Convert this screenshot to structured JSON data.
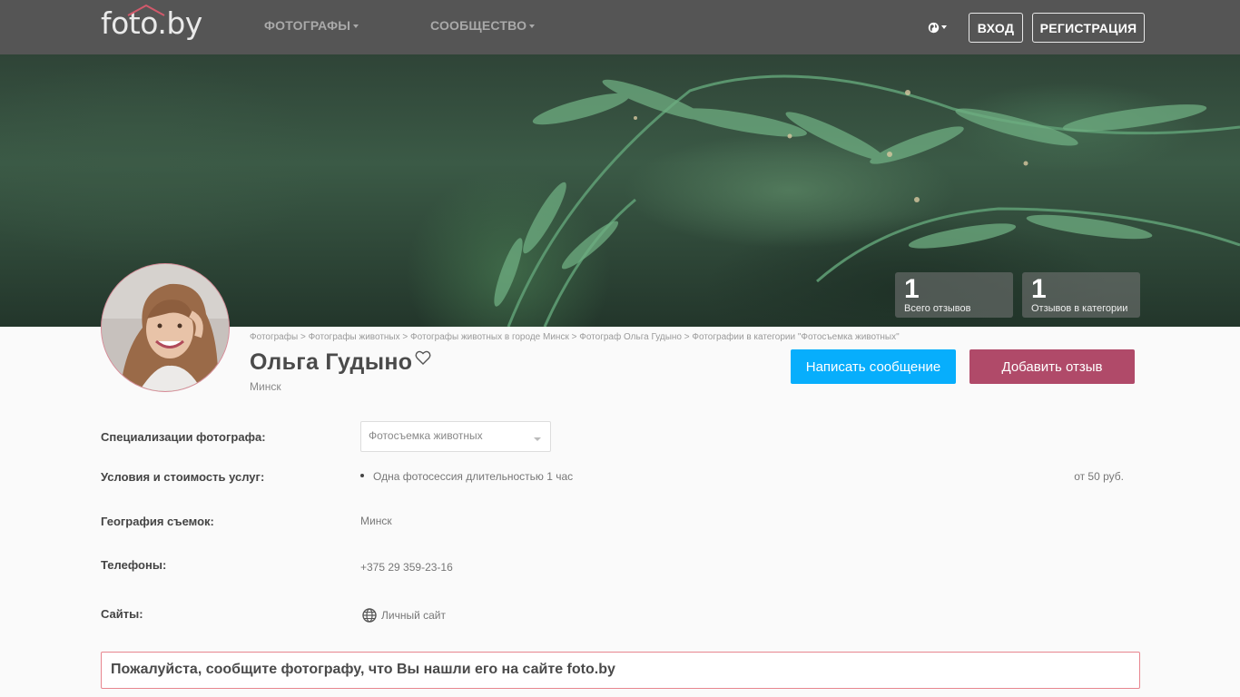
{
  "header": {
    "logo_text": "foto.by",
    "nav": [
      {
        "label": "ФОТОГРАФЫ"
      },
      {
        "label": "СООБЩЕСТВО"
      }
    ],
    "login_label": "ВХОД",
    "register_label": "РЕГИСТРАЦИЯ",
    "language_icon": "globe-icon"
  },
  "hero": {
    "stats": [
      {
        "value": "1",
        "label": "Всего отзывов"
      },
      {
        "value": "1",
        "label": "Отзывов в категории"
      }
    ]
  },
  "profile": {
    "breadcrumb": [
      "Фотографы",
      "Фотографы животных",
      "Фотографы животных в городе Минск",
      "Фотограф Ольга Гудыно",
      "Фотографии в категории \"Фотосъемка животных\""
    ],
    "breadcrumb_separator": ">",
    "name": "Ольга Гудыно",
    "city": "Минск",
    "message_button": "Написать сообщение",
    "review_button": "Добавить отзыв"
  },
  "details": {
    "specializations_label": "Специализации фотографа:",
    "specialization_selected": "Фотосъемка животных",
    "conditions_label": "Условия и стоимость услуг:",
    "service": "Одна фотосессия длительностью 1 час",
    "service_price": "от 50 руб.",
    "geography_label": "География съемок:",
    "geography_value": "Минск",
    "phones_label": "Телефоны:",
    "phone_value": "+375 29 359-23-16",
    "sites_label": "Сайты:",
    "site_value": "Личный сайт"
  },
  "notice": {
    "text": "Пожалуйста, сообщите фотографу, что Вы нашли его на сайте foto.by"
  },
  "colors": {
    "nav_bg": "#555555",
    "message_button": "#07aefc",
    "review_button": "#b04a69",
    "notice_border": "#e8868f"
  }
}
